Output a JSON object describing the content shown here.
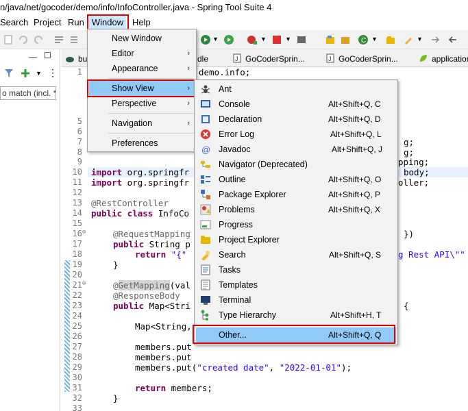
{
  "window": {
    "title": "n/java/net/gocoder/demo/info/InfoController.java - Spring Tool Suite 4"
  },
  "menubar": {
    "items": [
      {
        "label": "Search"
      },
      {
        "label": "Project"
      },
      {
        "label": "Run"
      },
      {
        "label": "Window"
      },
      {
        "label": "Help"
      }
    ]
  },
  "left": {
    "filter_value": "o match (incl. *"
  },
  "tabs": [
    {
      "label": "bu"
    },
    {
      "label": "dle"
    },
    {
      "label": "GoCoderSprin..."
    },
    {
      "label": "GoCoderSprin..."
    },
    {
      "label": "application"
    }
  ],
  "window_menu": {
    "items": [
      {
        "label": "New Window"
      },
      {
        "label": "Editor"
      },
      {
        "label": "Appearance"
      },
      {
        "label": "Show View"
      },
      {
        "label": "Perspective"
      },
      {
        "label": "Navigation"
      },
      {
        "label": "Preferences"
      }
    ]
  },
  "show_view_menu": {
    "items": [
      {
        "label": "Ant",
        "shortcut": "",
        "icon": "ant-icon"
      },
      {
        "label": "Console",
        "shortcut": "Alt+Shift+Q, C",
        "icon": "console-icon"
      },
      {
        "label": "Declaration",
        "shortcut": "Alt+Shift+Q, D",
        "icon": "declaration-icon"
      },
      {
        "label": "Error Log",
        "shortcut": "Alt+Shift+Q, L",
        "icon": "error-log-icon"
      },
      {
        "label": "Javadoc",
        "shortcut": "Alt+Shift+Q, J",
        "icon": "javadoc-icon"
      },
      {
        "label": "Navigator (Deprecated)",
        "shortcut": "",
        "icon": "navigator-icon"
      },
      {
        "label": "Outline",
        "shortcut": "Alt+Shift+Q, O",
        "icon": "outline-icon"
      },
      {
        "label": "Package Explorer",
        "shortcut": "Alt+Shift+Q, P",
        "icon": "package-explorer-icon"
      },
      {
        "label": "Problems",
        "shortcut": "Alt+Shift+Q, X",
        "icon": "problems-icon"
      },
      {
        "label": "Progress",
        "shortcut": "",
        "icon": "progress-icon"
      },
      {
        "label": "Project Explorer",
        "shortcut": "",
        "icon": "project-explorer-icon"
      },
      {
        "label": "Search",
        "shortcut": "Alt+Shift+Q, S",
        "icon": "search-icon"
      },
      {
        "label": "Tasks",
        "shortcut": "",
        "icon": "tasks-icon"
      },
      {
        "label": "Templates",
        "shortcut": "",
        "icon": "templates-icon"
      },
      {
        "label": "Terminal",
        "shortcut": "",
        "icon": "terminal-icon"
      },
      {
        "label": "Type Hierarchy",
        "shortcut": "Alt+Shift+H, T",
        "icon": "type-hierarchy-icon"
      },
      {
        "label": "Other...",
        "shortcut": "Alt+Shift+Q, Q",
        "icon": ""
      }
    ]
  },
  "code": {
    "line_numbers": [
      "1",
      "5",
      "6",
      "7",
      "8",
      "9",
      "10",
      "11",
      "12",
      "13",
      "14",
      "15",
      "16",
      "17",
      "18",
      "19",
      "20",
      "21",
      "22",
      "23",
      "24",
      "25",
      "26",
      "27",
      "28",
      "29",
      "30",
      "31",
      "32",
      "33"
    ],
    "fragments": {
      "l1": "demo.info;",
      "l6": "g;",
      "l7": "g;",
      "l8": "pping;",
      "l9_import": "import",
      "l9_text": " org.springfr",
      "l9_tail": "body;",
      "l10_import": "import",
      "l10_text": " org.springfr",
      "l10_tail": "oller;",
      "l12": "@RestController",
      "l13_kw": "public class",
      "l13_text": " InfoCo",
      "l15": "@RequestMapping",
      "l15_tail": "})",
      "l16_kw": "public",
      "l16_text": " String p",
      "l17_kw": "return",
      "l17_str": "\"{\"",
      "l17_tail": "g Rest API\\\"\"",
      "l18": "}",
      "l20_at": "@",
      "l20_ann": "GetMapping",
      "l20_text": "(val",
      "l21": "@ResponseBody",
      "l22_kw": "public",
      "l22_text": " Map<Stri",
      "l22_tail": "{",
      "l24": "Map<String,",
      "l26": "members.put",
      "l27": "members.put",
      "l28_a": "members.put(",
      "l28_s1": "\"created date\"",
      "l28_b": ", ",
      "l28_s2": "\"2022-01-01\"",
      "l28_c": ");",
      "l30_kw": "return",
      "l30_text": " members;",
      "l31": "}"
    }
  }
}
